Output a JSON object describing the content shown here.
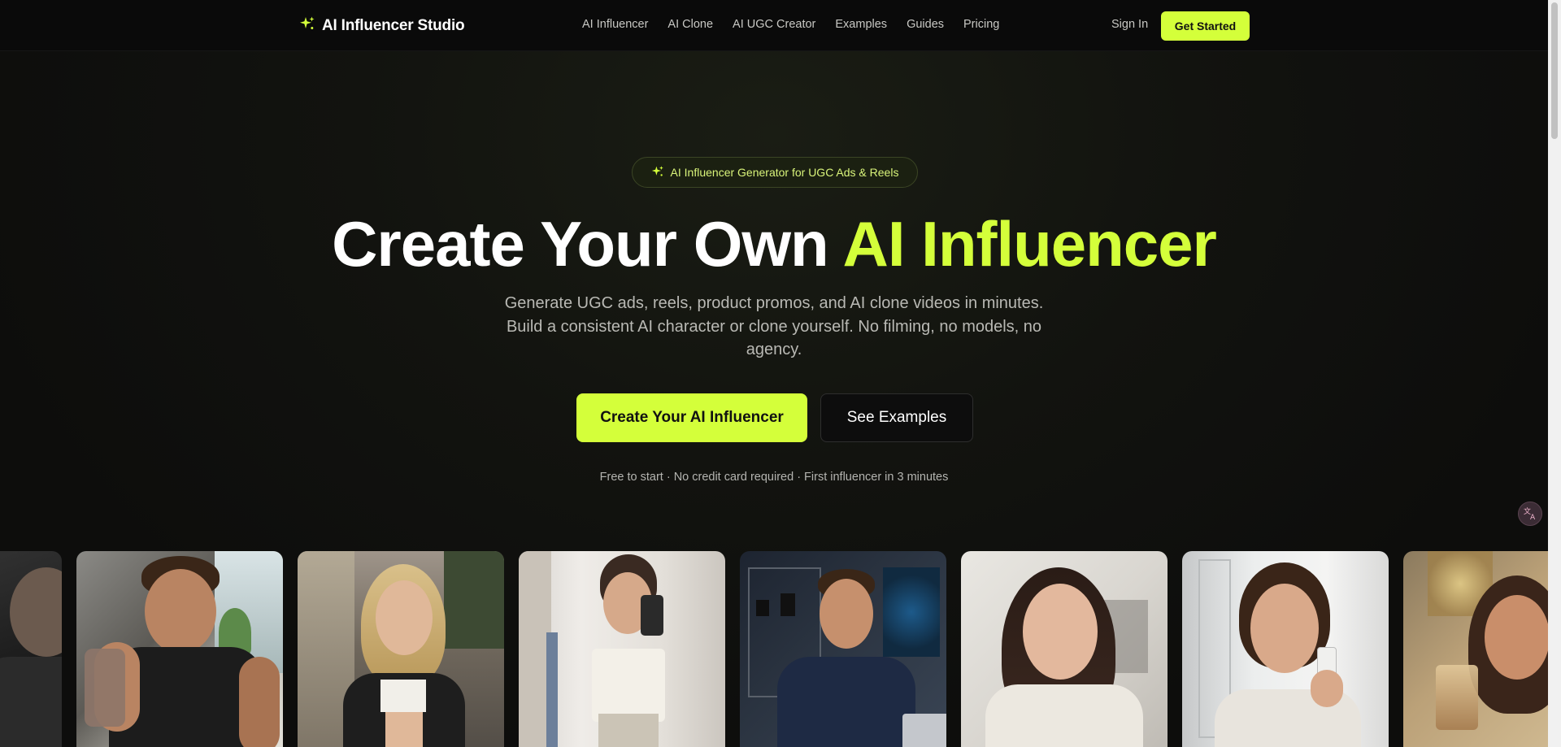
{
  "nav": {
    "logo_text": "AI Influencer Studio",
    "links": [
      "AI Influencer",
      "AI Clone",
      "AI UGC Creator",
      "Examples",
      "Guides",
      "Pricing"
    ],
    "sign_in": "Sign In",
    "get_started": "Get Started"
  },
  "hero": {
    "badge": "AI Influencer Generator for UGC Ads & Reels",
    "headline_plain": "Create Your Own ",
    "headline_accent": "AI Influencer",
    "subtitle": "Generate UGC ads, reels, product promos, and AI clone videos in minutes. Build a consistent AI character or clone yourself. No filming, no models, no agency.",
    "primary_cta": "Create Your AI Influencer",
    "secondary_cta": "See Examples",
    "fineprint": "Free to start · No credit card required · First influencer in 3 minutes"
  },
  "colors": {
    "accent": "#d4ff3a",
    "background": "#0c0c0b"
  }
}
